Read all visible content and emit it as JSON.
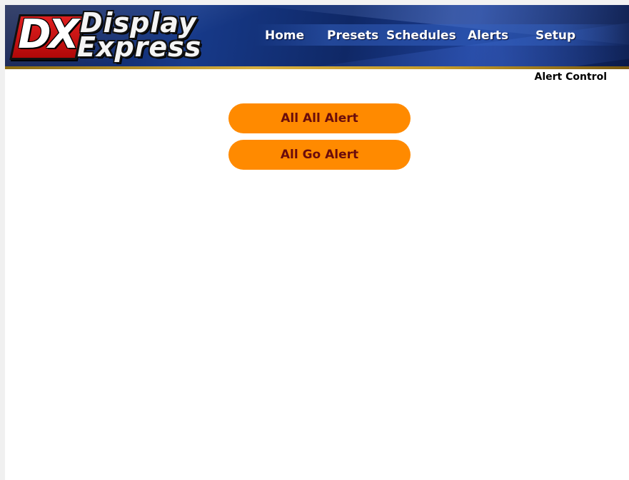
{
  "brand": {
    "logo_letters": "DX",
    "logo_line1": "Display",
    "logo_line2": "Express"
  },
  "nav": {
    "home": "Home",
    "presets": "Presets",
    "schedules": "Schedules",
    "alerts": "Alerts",
    "setup": "Setup"
  },
  "page": {
    "title": "Alert Control"
  },
  "alerts": {
    "buttons": [
      "All All Alert",
      "All Go Alert"
    ]
  },
  "colors": {
    "button_bg": "#ff8a00",
    "button_text": "#6a0c0c",
    "banner": "#173a8a",
    "logo_red": "#d01818"
  }
}
